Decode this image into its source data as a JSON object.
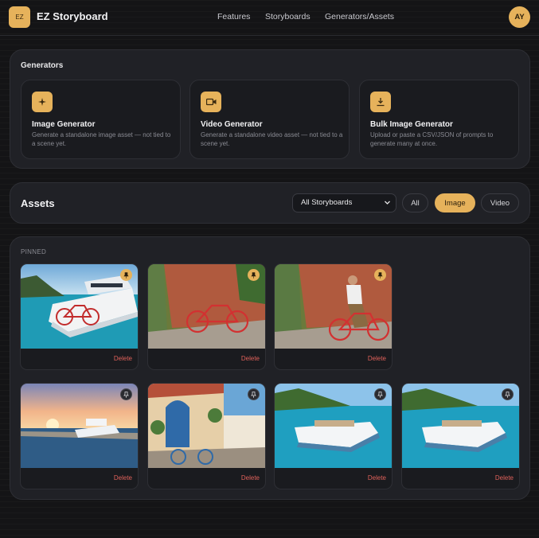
{
  "header": {
    "logo_text": "EZ",
    "app_name": "EZ Storyboard",
    "nav": [
      "Features",
      "Storyboards",
      "Generators/Assets"
    ],
    "avatar": "AY"
  },
  "generators": {
    "title": "Generators",
    "cards": [
      {
        "icon": "sparkle-icon",
        "title": "Image Generator",
        "desc": "Generate a standalone image asset — not tied to a scene yet."
      },
      {
        "icon": "video-camera-icon",
        "title": "Video Generator",
        "desc": "Generate a standalone video asset — not tied to a scene yet."
      },
      {
        "icon": "download-icon",
        "title": "Bulk Image Generator",
        "desc": "Upload or paste a CSV/JSON of prompts to generate many at once."
      }
    ]
  },
  "assets": {
    "title": "Assets",
    "storyboard_select": "All Storyboards",
    "filters": [
      "All",
      "Image",
      "Video"
    ],
    "active_filter": "Image",
    "pinned_label": "PINNED",
    "pinned": [
      {
        "scene": "yacht-bicycle",
        "pinned": true,
        "delete_label": "Delete"
      },
      {
        "scene": "alley-bicycle",
        "pinned": true,
        "delete_label": "Delete"
      },
      {
        "scene": "alley-rider",
        "pinned": true,
        "delete_label": "Delete"
      }
    ],
    "others": [
      {
        "scene": "sunset-yacht",
        "pinned": false,
        "delete_label": "Delete"
      },
      {
        "scene": "village-door",
        "pinned": false,
        "delete_label": "Delete"
      },
      {
        "scene": "cove-yacht",
        "pinned": false,
        "delete_label": "Delete"
      },
      {
        "scene": "cove-yacht",
        "pinned": false,
        "delete_label": "Delete"
      }
    ]
  },
  "colors": {
    "accent": "#e6b25b",
    "danger": "#e0615a",
    "panel": "#202126",
    "background": "#141416"
  }
}
